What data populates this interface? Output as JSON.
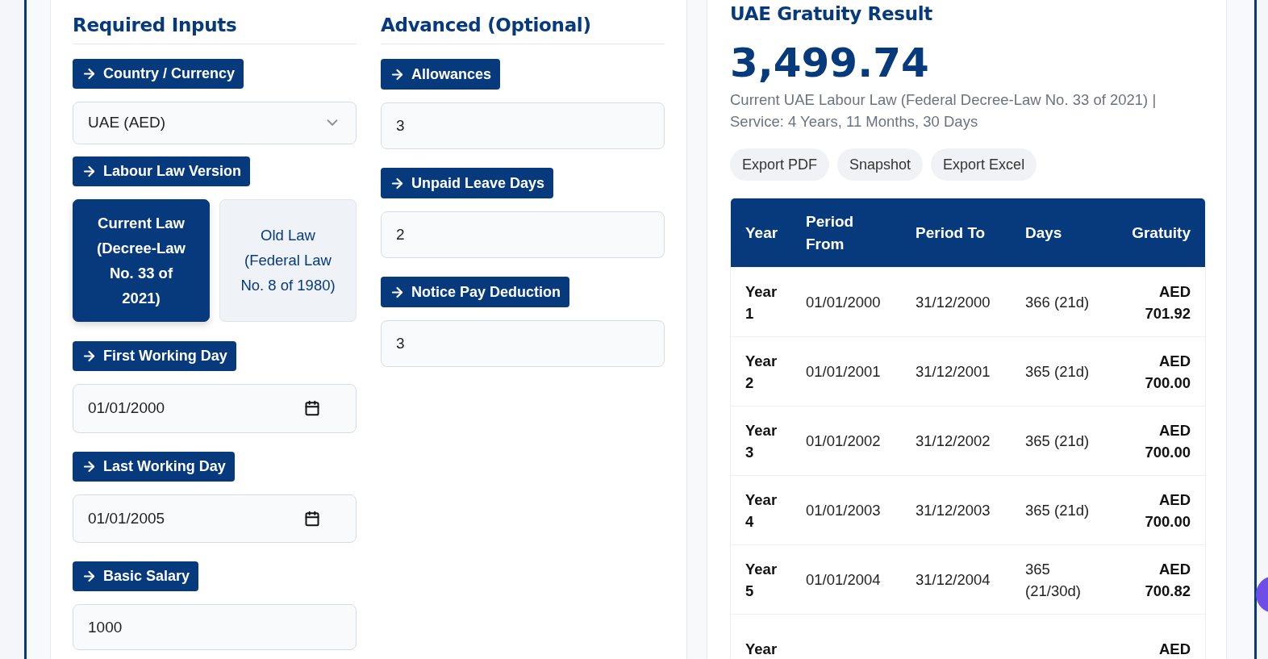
{
  "required_inputs": {
    "title": "Required Inputs",
    "fields": [
      {
        "kind": "select",
        "label": "Country / Currency",
        "value": "UAE (AED)"
      },
      {
        "kind": "toggle",
        "label": "Labour Law Version",
        "options": [
          {
            "label": "Current Law (Decree-Law No. 33 of 2021)",
            "selected": true
          },
          {
            "label": "Old Law (Federal Law No. 8 of 1980)",
            "selected": false
          }
        ]
      },
      {
        "kind": "date",
        "label": "First Working Day",
        "value": "01/01/2000"
      },
      {
        "kind": "date",
        "label": "Last Working Day",
        "value": "01/01/2005"
      },
      {
        "kind": "text",
        "label": "Basic Salary",
        "value": "1000"
      }
    ]
  },
  "advanced": {
    "title": "Advanced (Optional)",
    "fields": [
      {
        "kind": "text",
        "label": "Allowances",
        "value": "3"
      },
      {
        "kind": "text",
        "label": "Unpaid Leave Days",
        "value": "2"
      },
      {
        "kind": "text",
        "label": "Notice Pay Deduction",
        "value": "3"
      }
    ]
  },
  "result": {
    "title": "UAE Gratuity Result",
    "amount": "3,499.74",
    "description": "Current UAE Labour Law (Federal Decree-Law No. 33 of 2021) | Service: 4 Years, 11 Months, 30 Days",
    "actions": [
      "Export PDF",
      "Snapshot",
      "Export Excel"
    ],
    "table": {
      "columns": [
        "Year",
        "Period From",
        "Period To",
        "Days",
        "Gratuity"
      ],
      "rows": [
        {
          "year": "Year 1",
          "period_from": "01/01/2000",
          "period_to": "31/12/2000",
          "days": "366 (21d)",
          "gratuity": "AED 701.92"
        },
        {
          "year": "Year 2",
          "period_from": "01/01/2001",
          "period_to": "31/12/2001",
          "days": "365 (21d)",
          "gratuity": "AED 700.00"
        },
        {
          "year": "Year 3",
          "period_from": "01/01/2002",
          "period_to": "31/12/2002",
          "days": "365 (21d)",
          "gratuity": "AED 700.00"
        },
        {
          "year": "Year 4",
          "period_from": "01/01/2003",
          "period_to": "31/12/2003",
          "days": "365 (21d)",
          "gratuity": "AED 700.00"
        },
        {
          "year": "Year 5",
          "period_from": "01/01/2004",
          "period_to": "31/12/2004",
          "days": "365 (21/30d)",
          "gratuity": "AED 700.82"
        },
        {
          "year": "Year",
          "gratuity": "AED"
        }
      ]
    }
  }
}
